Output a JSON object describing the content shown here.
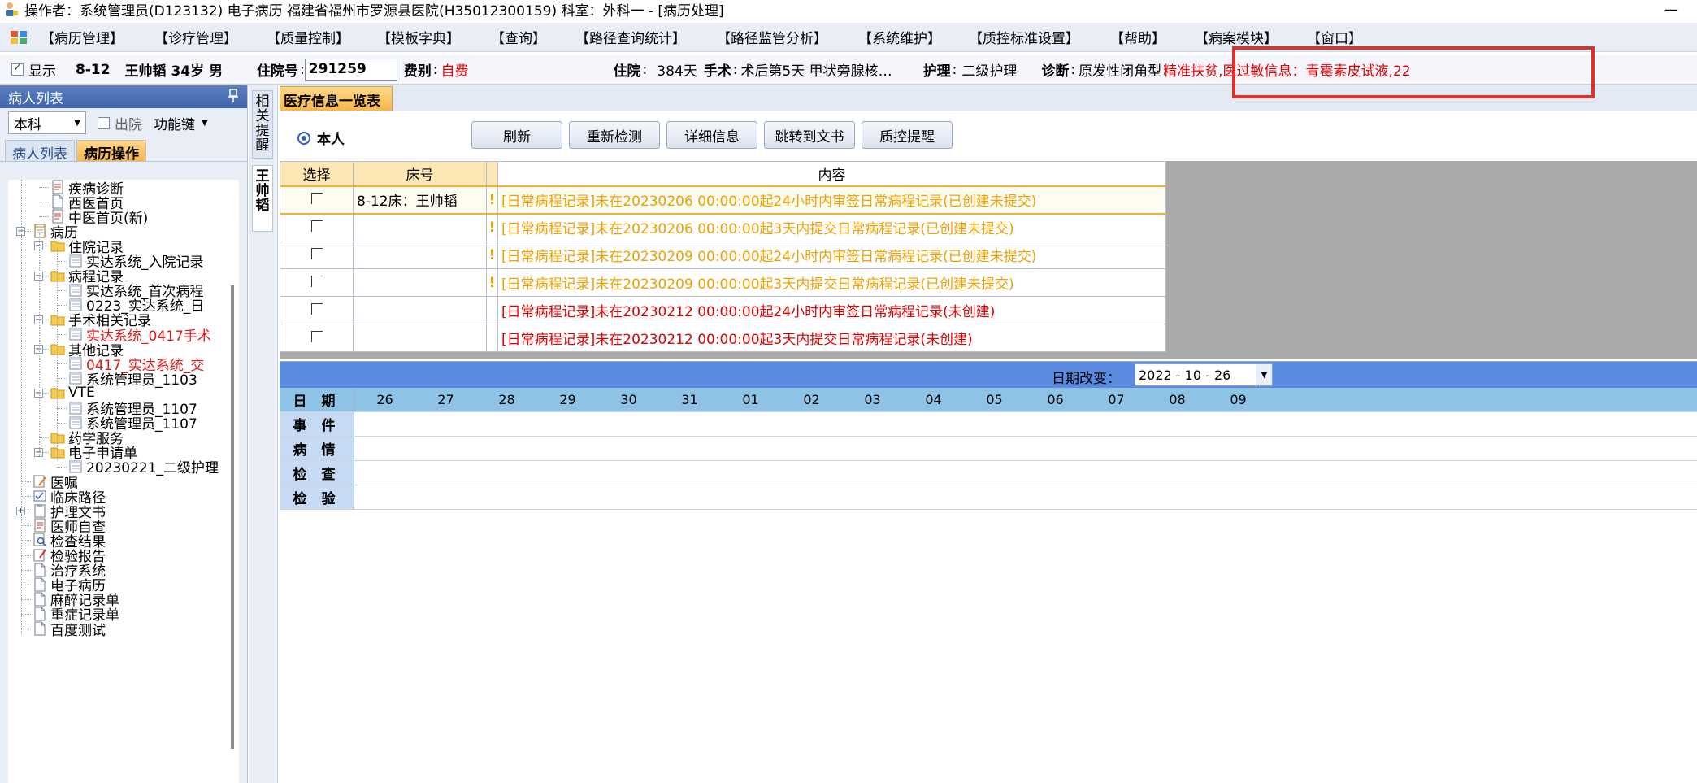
{
  "window": {
    "title": "操作者：系统管理员(D123132) 电子病历  福建省福州市罗源县医院(H35012300159)  科室：外科一 - [病历处理]",
    "minimize": "—"
  },
  "menu": {
    "items": [
      "【病历管理】",
      "【诊疗管理】",
      "【质量控制】",
      "【模板字典】",
      "【查询】",
      "【路径查询统计】",
      "【路径监管分析】",
      "【系统维护】",
      "【质控标准设置】",
      "【帮助】",
      "【病案模块】",
      "【窗口】"
    ]
  },
  "infobar": {
    "show_label": "显示",
    "bed": "8-12",
    "name_age_sex": "王帅韬 34岁 男",
    "inpatient_label": "住院号",
    "inpatient_no": "291259",
    "fee_label": "费别",
    "fee_value": "自费",
    "stay_label": "住院",
    "stay_value": "384天",
    "surgery_label": "手术",
    "surgery_value": "术后第5天  甲状旁腺核…",
    "nursing_label": "护理",
    "nursing_value": "二级护理",
    "diag_label": "诊断",
    "diag_value": "原发性闭角型",
    "alert": "精准扶贫,医过敏信息：青霉素皮试液,22"
  },
  "left": {
    "header": "病人列表",
    "pin": "📌",
    "dept": "本科",
    "discharge_label": "出院",
    "function_key": "功能键",
    "tabs": [
      "病人列表",
      "病历操作"
    ],
    "tree": [
      {
        "label": "疾病诊断"
      },
      {
        "label": "西医首页"
      },
      {
        "label": "中医首页(新)"
      },
      {
        "label": "病历"
      },
      {
        "label": "住院记录"
      },
      {
        "label": "实达系统_入院记录"
      },
      {
        "label": "病程记录"
      },
      {
        "label": "实达系统_首次病程"
      },
      {
        "label": "0223_实达系统_日"
      },
      {
        "label": "手术相关记录"
      },
      {
        "label": "实达系统_0417手术"
      },
      {
        "label": "其他记录"
      },
      {
        "label": "0417_实达系统_交"
      },
      {
        "label": "系统管理员_1103"
      },
      {
        "label": "VTE"
      },
      {
        "label": "系统管理员_1107"
      },
      {
        "label": "系统管理员_1107"
      },
      {
        "label": "药学服务"
      },
      {
        "label": "电子申请单"
      },
      {
        "label": "20230221_二级护理"
      },
      {
        "label": "医嘱"
      },
      {
        "label": "临床路径"
      },
      {
        "label": "护理文书"
      },
      {
        "label": "医师自查"
      },
      {
        "label": "检查结果"
      },
      {
        "label": "检验报告"
      },
      {
        "label": "治疗系统"
      },
      {
        "label": "电子病历"
      },
      {
        "label": "麻醉记录单"
      },
      {
        "label": "重症记录单"
      },
      {
        "label": "百度测试"
      }
    ]
  },
  "vtabs": [
    "相关提醒",
    "王帅韬"
  ],
  "main": {
    "tab": "医疗信息一览表",
    "radio_self": "本人",
    "buttons": [
      "刷新",
      "重新检测",
      "详细信息",
      "跳转到文书",
      "质控提醒"
    ],
    "columns": [
      "选择",
      "床号",
      "内容"
    ],
    "rows": [
      {
        "bed": "8-12床：王帅韬",
        "flag": "!",
        "content": "[日常病程记录]未在20230206 00:00:00起24小时内审签日常病程记录(已创建未提交)",
        "color": "#f0a000"
      },
      {
        "bed": "",
        "flag": "!",
        "content": "[日常病程记录]未在20230206 00:00:00起3天内提交日常病程记录(已创建未提交)",
        "color": "#f0a000"
      },
      {
        "bed": "",
        "flag": "!",
        "content": "[日常病程记录]未在20230209 00:00:00起24小时内审签日常病程记录(已创建未提交)",
        "color": "#f0a000"
      },
      {
        "bed": "",
        "flag": "!",
        "content": "[日常病程记录]未在20230209 00:00:00起3天内提交日常病程记录(已创建未提交)",
        "color": "#f0a000"
      },
      {
        "bed": "",
        "flag": "",
        "content": "[日常病程记录]未在20230212 00:00:00起24小时内审签日常病程记录(未创建)",
        "color": "#e00000"
      },
      {
        "bed": "",
        "flag": "",
        "content": "[日常病程记录]未在20230212 00:00:00起3天内提交日常病程记录(未创建)",
        "color": "#e00000"
      }
    ]
  },
  "timeline": {
    "date_label": "日期改变：",
    "date_value": "2022 - 10 - 26",
    "date_head": "日 期",
    "days": [
      "26",
      "27",
      "28",
      "29",
      "30",
      "31",
      "01",
      "02",
      "03",
      "04",
      "05",
      "06",
      "07",
      "08",
      "09"
    ],
    "rows": [
      "事 件",
      "病 情",
      "检 查",
      "检 验"
    ]
  }
}
